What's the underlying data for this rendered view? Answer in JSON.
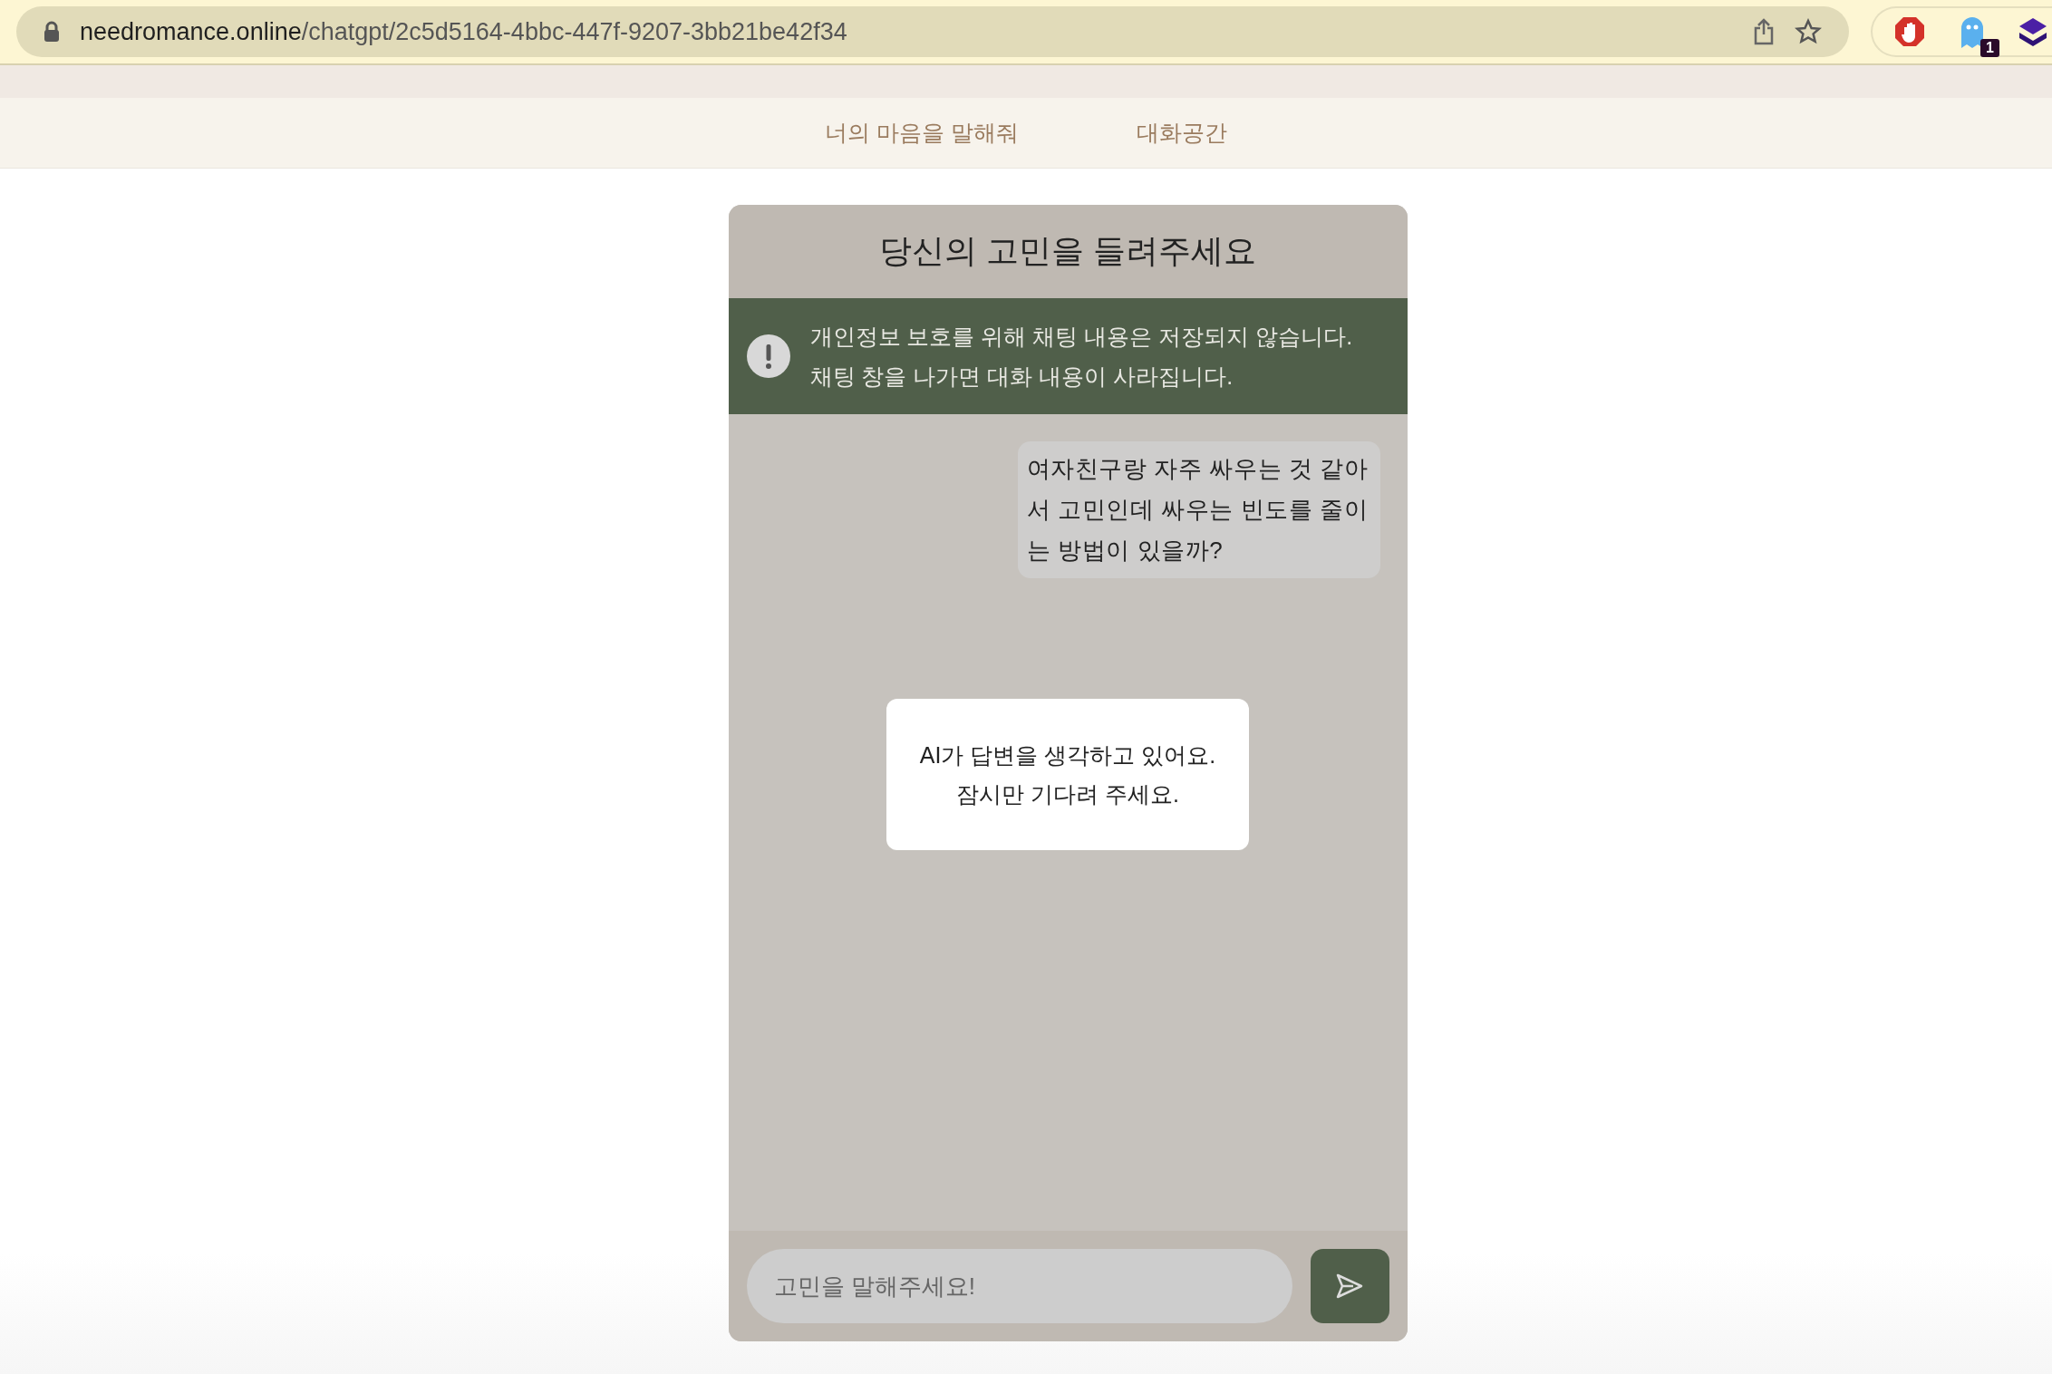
{
  "browser": {
    "url_host": "needromance.online",
    "url_path": "/chatgpt/2c5d5164-4bbc-447f-9207-3bb21be42f34",
    "extension_badge": "1"
  },
  "nav": {
    "items": [
      {
        "label": "너의 마음을 말해줘"
      },
      {
        "label": "대화공간"
      }
    ]
  },
  "chat": {
    "title": "당신의 고민을 들려주세요",
    "notice": [
      "개인정보 보호를 위해 채팅 내용은 저장되지 않습니다.",
      "채팅 창을 나가면 대화 내용이 사라집니다."
    ],
    "messages": [
      {
        "kind": "user",
        "text": "여자친구랑 자주 싸우는 것 같아서 고민인데 싸우는 빈도를 줄이는 방법이 있을까?"
      }
    ],
    "loading": [
      "AI가 답변을 생각하고 있어요.",
      "잠시만 기다려 주세요."
    ],
    "input": {
      "placeholder": "고민을 말해주세요!"
    }
  }
}
